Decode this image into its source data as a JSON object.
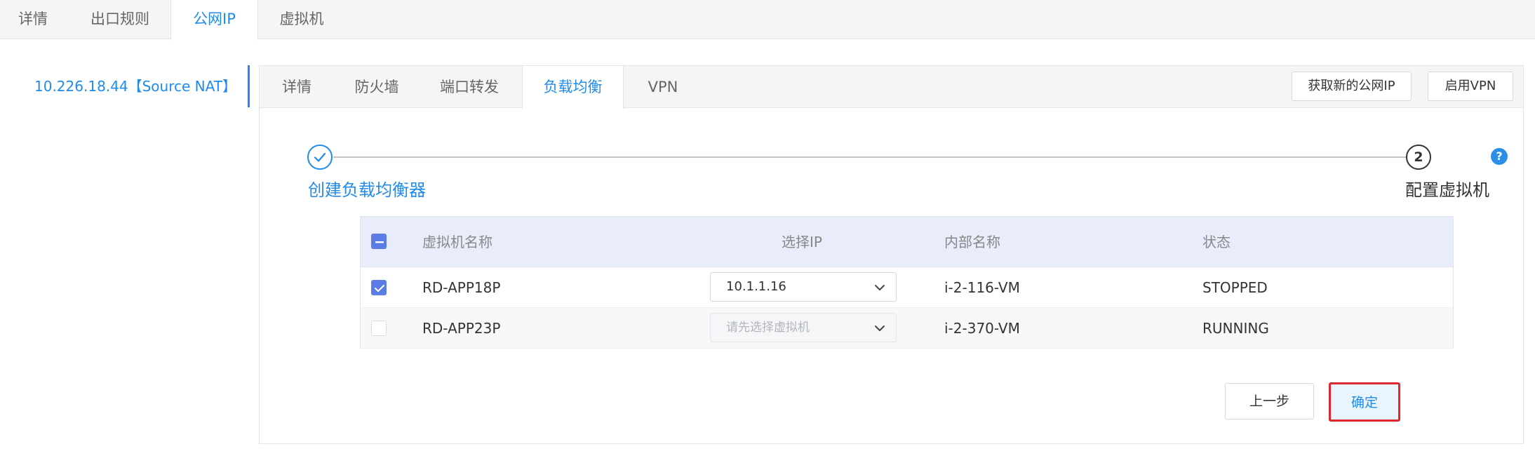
{
  "top_tabs": [
    {
      "label": "详情"
    },
    {
      "label": "出口规则"
    },
    {
      "label": "公网IP",
      "active": true
    },
    {
      "label": "虚拟机"
    }
  ],
  "ip_list": [
    {
      "label": "10.226.18.44【Source NAT】",
      "active": true
    }
  ],
  "sub_tabs": [
    {
      "label": "详情"
    },
    {
      "label": "防火墙"
    },
    {
      "label": "端口转发"
    },
    {
      "label": "负载均衡",
      "active": true
    },
    {
      "label": "VPN"
    }
  ],
  "actions": {
    "acquire_ip": "获取新的公网IP",
    "enable_vpn": "启用VPN"
  },
  "steps": [
    {
      "number": "✓",
      "label": "创建负载均衡器",
      "status": "done"
    },
    {
      "number": "2",
      "label": "配置虚拟机",
      "status": "current"
    }
  ],
  "help_icon": "?",
  "table": {
    "headers": {
      "name": "虚拟机名称",
      "ip": "选择IP",
      "internal": "内部名称",
      "status": "状态"
    },
    "rows": [
      {
        "checked": true,
        "name": "RD-APP18P",
        "ip": "10.1.1.16",
        "ip_placeholder": "",
        "internal": "i-2-116-VM",
        "status": "STOPPED"
      },
      {
        "checked": false,
        "name": "RD-APP23P",
        "ip": "",
        "ip_placeholder": "请先选择虚拟机",
        "internal": "i-2-370-VM",
        "status": "RUNNING"
      }
    ]
  },
  "buttons": {
    "prev": "上一步",
    "confirm": "确定"
  },
  "colors": {
    "accent": "#1f8ceb",
    "checkbox": "#5b7be6",
    "highlight_border": "#e0262f"
  }
}
